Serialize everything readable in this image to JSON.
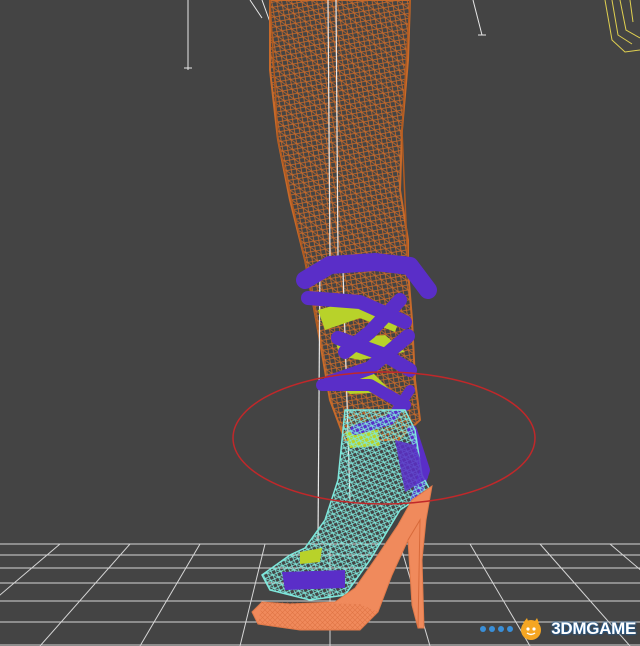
{
  "viewport": {
    "background": "#444444",
    "grid_color": "#d6d6d6",
    "selection_ring_color": "#c0282a"
  },
  "model": {
    "leg_wireframe_color": "#c86a2a",
    "strap_color": "#5a2ec8",
    "strap_accent_color": "#b8d22a",
    "shoe_mesh_color": "#7fe8dc",
    "sole_color": "#f08a5c",
    "bone_color": "#e8e8e8"
  },
  "watermark": {
    "text": "3DMGAME",
    "icon": "3dm-logo-icon",
    "brand_color": "#f5a623"
  }
}
